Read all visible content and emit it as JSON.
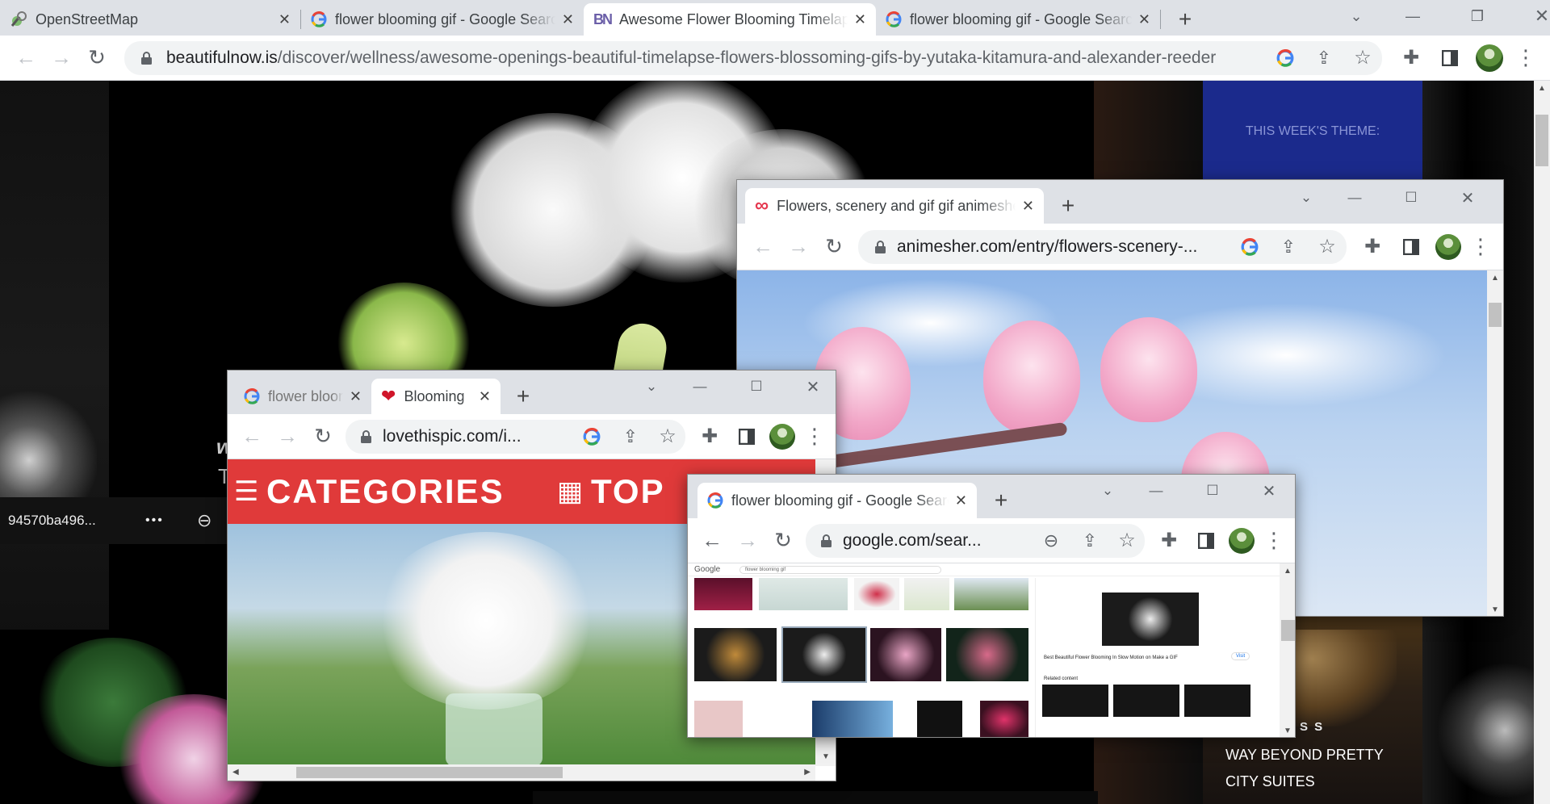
{
  "main": {
    "tabs": [
      {
        "title": "OpenStreetMap"
      },
      {
        "title": "flower blooming gif - Google Search"
      },
      {
        "title": "Awesome Flower Blooming Timelapse"
      },
      {
        "title": "flower blooming gif - Google Search"
      }
    ],
    "url_host": "beautifulnow.is",
    "url_path": "/discover/wellness/awesome-openings-beautiful-timelapse-flowers-blossoming-gifs-by-yutaka-kitamura-and-alexander-reeder",
    "page": {
      "theme_label": "THIS WEEK'S THEME:",
      "bar_id": "94570ba496...",
      "bar_more": "•••",
      "ad_line1": "S S",
      "ad_line2": "WAY BEYOND PRETTY",
      "ad_line3": "CITY SUITES",
      "partial_w": "w",
      "partial_t": "T"
    }
  },
  "anime": {
    "tab_title": "Flowers, scenery and gif gif animesher",
    "url": "animesher.com/entry/flowers-scenery-..."
  },
  "love": {
    "tabs": [
      {
        "title": "flower blooming"
      },
      {
        "title": "Blooming"
      }
    ],
    "url": "lovethispic.com/i...",
    "nav_categories": "CATEGORIES",
    "nav_top": "TOP"
  },
  "gsearch": {
    "tab_title": "flower blooming gif - Google Search",
    "url": "google.com/sear...",
    "mini": {
      "logo": "Google",
      "query": "flower blooming gif",
      "panel_title": "Best Beautiful Flower Blooming In Slow Motion on Make a GIF",
      "related": "Related content",
      "visit": "Visit"
    }
  },
  "colors": {
    "tabstrip": "#dee1e6",
    "love_red": "#e03a3a",
    "theme_blue": "#1b2a8c"
  }
}
